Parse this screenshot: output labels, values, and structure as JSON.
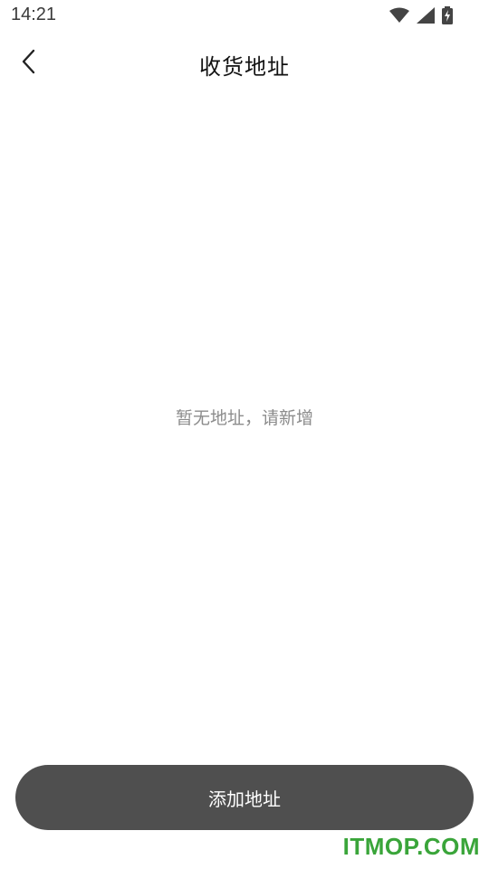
{
  "status_bar": {
    "time": "14:21",
    "icons": [
      "wifi-icon",
      "signal-icon",
      "battery-charging-icon"
    ]
  },
  "header": {
    "title": "收货地址",
    "back_icon": "chevron-left-icon"
  },
  "empty_state": {
    "message": "暂无地址，请新增"
  },
  "footer": {
    "add_label": "添加地址"
  },
  "watermark": "ITMOP.COM",
  "colors": {
    "button_bg": "#4f4f4f",
    "empty_text": "#8c8c8c",
    "watermark": "#3aa53a"
  }
}
